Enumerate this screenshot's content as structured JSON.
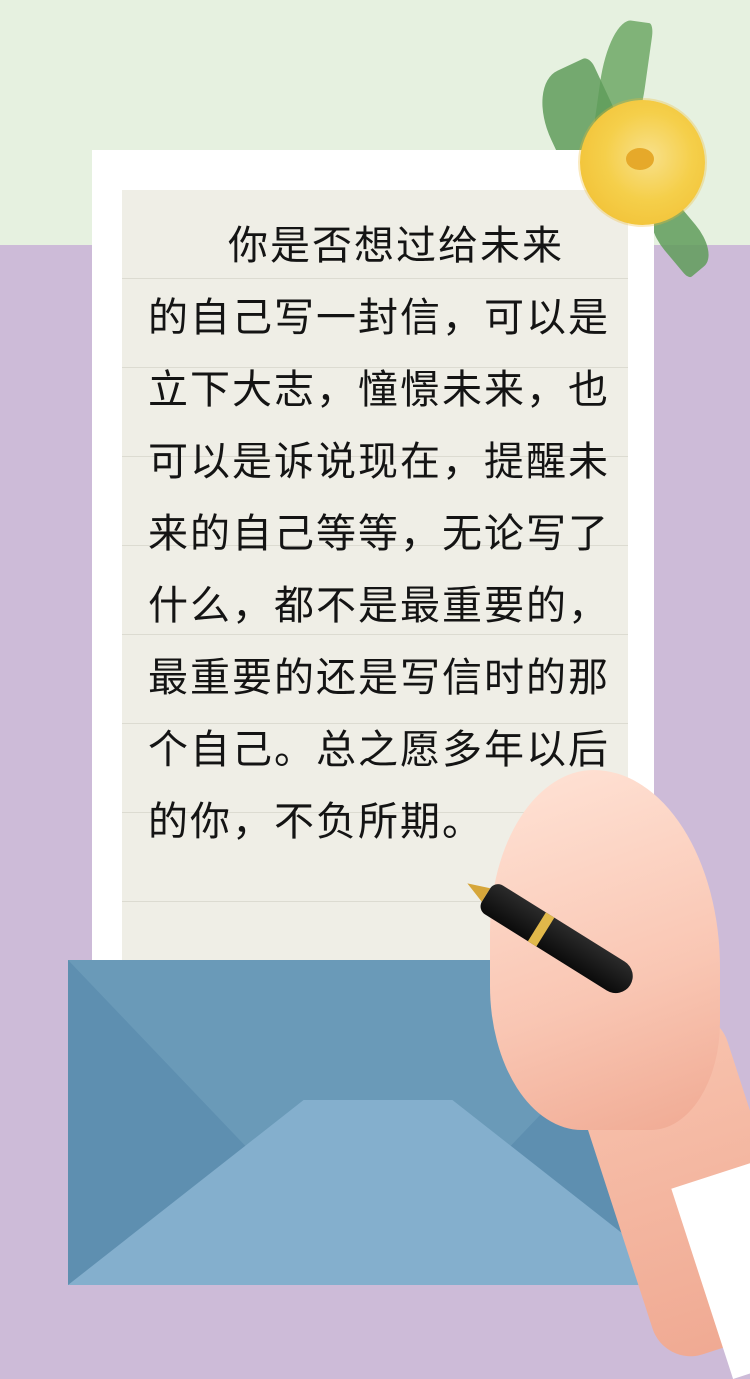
{
  "letter": {
    "lines": [
      "你是否想过给未来",
      "的自己写一封信，可以是",
      "立下大志，憧憬未来，也",
      "可以是诉说现在，提醒未",
      "来的自己等等，无论写了",
      "什么，都不是最重要的，",
      "最重要的还是写信时的那",
      "个自己。总之愿多年以后",
      "的你，不负所期。"
    ]
  },
  "colors": {
    "top_background": "#e6f1e0",
    "bottom_background": "#cdbbd8",
    "paper": "#efeee6",
    "envelope": "#6a9ab8",
    "flower": "#f5cf4a"
  },
  "decorations": [
    "flower-icon",
    "envelope-icon",
    "hand-icon",
    "fountain-pen-icon"
  ]
}
